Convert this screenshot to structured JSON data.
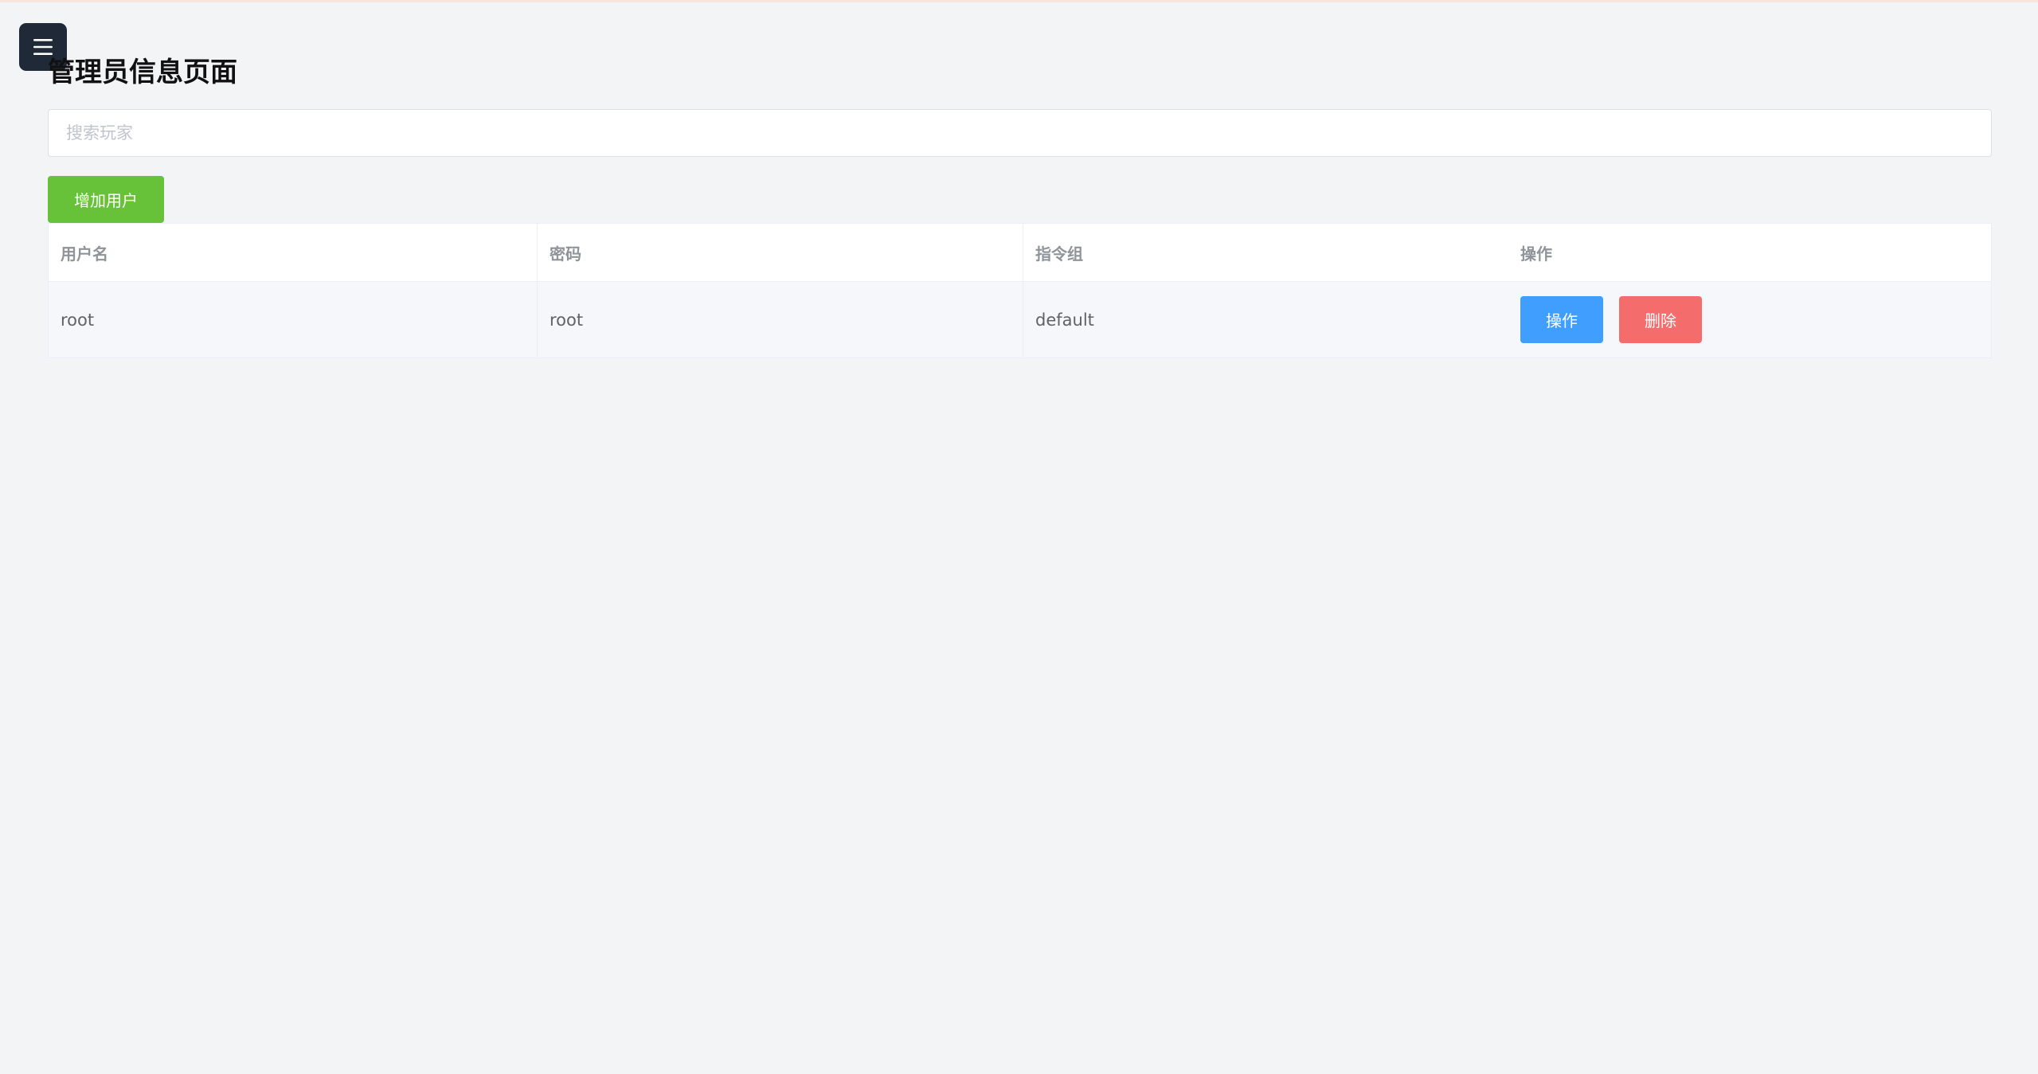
{
  "header": {
    "title": "管理员信息页面",
    "menu_icon": "hamburger-menu-icon"
  },
  "search": {
    "placeholder": "搜索玩家",
    "value": ""
  },
  "toolbar": {
    "add_user_label": "增加用户"
  },
  "table": {
    "columns": [
      "用户名",
      "密码",
      "指令组",
      "操作"
    ],
    "rows": [
      {
        "username": "root",
        "password": "root",
        "command_group": "default",
        "actions": {
          "operate_label": "操作",
          "delete_label": "删除"
        }
      }
    ]
  },
  "colors": {
    "menu_button": "#1f2937",
    "add_button": "#67c23a",
    "operate_button": "#409eff",
    "delete_button": "#f56c6c",
    "background": "#f3f4f6"
  }
}
